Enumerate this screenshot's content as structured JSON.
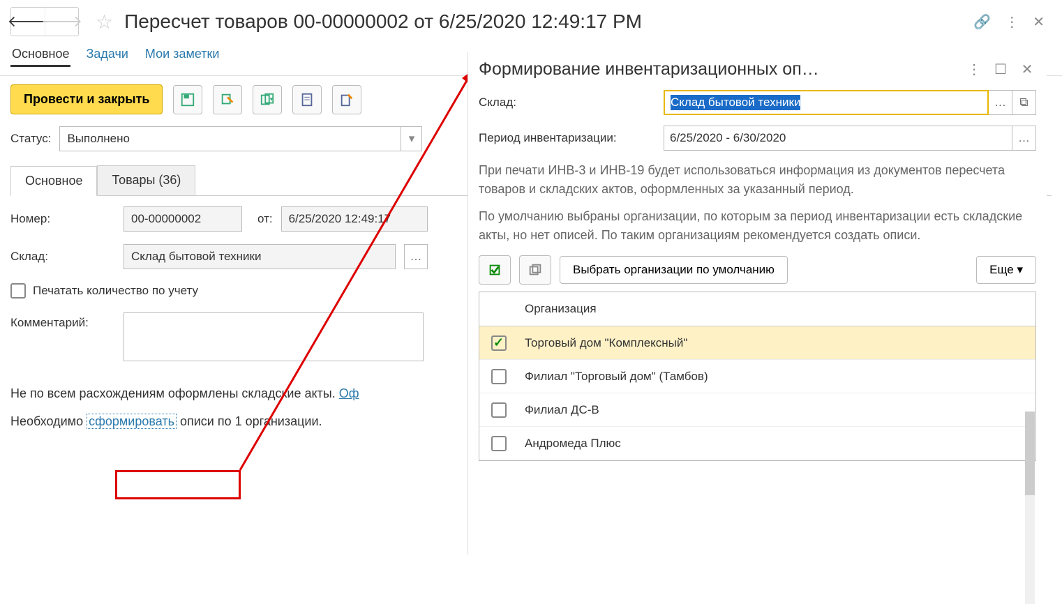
{
  "header": {
    "title": "Пересчет товаров 00-00000002 от 6/25/2020 12:49:17 PM"
  },
  "tabs": {
    "main": "Основное",
    "tasks": "Задачи",
    "notes": "Мои заметки"
  },
  "toolbar": {
    "post_and_close": "Провести и закрыть"
  },
  "status": {
    "label": "Статус:",
    "value": "Выполнено"
  },
  "inner_tabs": {
    "main": "Основное",
    "goods": "Товары (36)"
  },
  "form": {
    "number_label": "Номер:",
    "number": "00-00000002",
    "date_label": "от:",
    "date": "6/25/2020 12:49:17",
    "warehouse_label": "Склад:",
    "warehouse": "Склад бытовой техники",
    "print_qty": "Печатать количество по учету",
    "comment_label": "Комментарий:"
  },
  "bottom": {
    "line1_before": "Не по всем расхождениям оформлены складские акты. ",
    "line1_link": "Оф",
    "line2_before": "Необходимо ",
    "line2_link": "сформировать",
    "line2_after": " описи по 1 организации."
  },
  "popup": {
    "title": "Формирование инвентаризационных оп…",
    "warehouse_label": "Склад:",
    "warehouse": "Склад бытовой техники",
    "period_label": "Период инвентаризации:",
    "period": "6/25/2020 - 6/30/2020",
    "info1": "При печати ИНВ-3 и ИНВ-19 будет использоваться информация из документов пересчета товаров и складских актов, оформленных за указанный период.",
    "info2": "По умолчанию выбраны организации, по которым за период инвентаризации есть складские акты, но нет описей. По таким организациям рекомендуется создать описи.",
    "default_orgs": "Выбрать организации по умолчанию",
    "more": "Еще",
    "grid_header": "Организация",
    "rows": [
      {
        "name": "Торговый дом \"Комплексный\"",
        "checked": true,
        "selected": true
      },
      {
        "name": "Филиал \"Торговый дом\" (Тамбов)",
        "checked": false,
        "selected": false
      },
      {
        "name": "Филиал ДС-В",
        "checked": false,
        "selected": false
      },
      {
        "name": "Андромеда Плюс",
        "checked": false,
        "selected": false
      }
    ]
  }
}
